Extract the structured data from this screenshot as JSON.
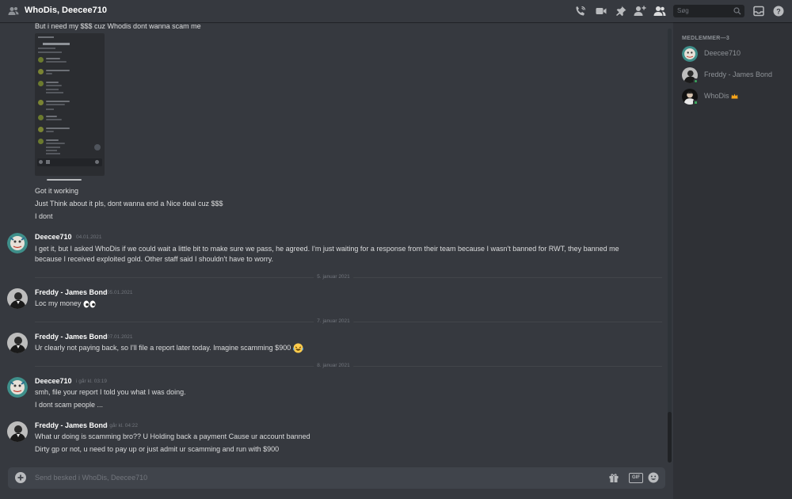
{
  "header": {
    "title": "WhoDis, Deecee710",
    "search_placeholder": "Søg",
    "icons": [
      "group-dm-icon",
      "call-icon",
      "video-icon",
      "pin-icon",
      "add-member-icon",
      "members-icon",
      "search-icon",
      "inbox-icon",
      "help-icon"
    ]
  },
  "messages": {
    "m0_line1": "But i need my $$$ cuz Whodis dont wanna scam me",
    "m0_line2": "Got it working",
    "m0_line3": "Just Think about it pls, dont wanna end a Nice deal cuz $$$",
    "m0_line4": "I dont",
    "m1_author": "Deecee710",
    "m1_time": "04.01.2021",
    "m1_line1": "I get it, but I asked WhoDis if we could wait a little bit to make sure we pass, he agreed. I'm just waiting for a response from their team because I wasn't banned for RWT, they banned me",
    "m1_line2": "because I received exploited gold. Other staff said I shouldn't have to worry.",
    "div1": "5. januar 2021",
    "m2_author": "Freddy - James Bond",
    "m2_time": "05.01.2021",
    "m2_line1": "Loc my money",
    "div2": "7. januar 2021",
    "m3_author": "Freddy - James Bond",
    "m3_time": "07.01.2021",
    "m3_line1": "Ur clearly not paying back, so I'll file a report later today. Imagine scamming $900",
    "div3": "8. januar 2021",
    "m4_author": "Deecee710",
    "m4_time": "i går kl. 03:19",
    "m4_line1": "smh, file your report I told you what I was doing.",
    "m4_line2": "I dont scam people ...",
    "m5_author": "Freddy - James Bond",
    "m5_time": "i går kl. 04:22",
    "m5_line1": "What ur doing is scamming bro?? U Holding back a payment Cause ur account banned",
    "m5_line2": "Dirty gp or not, u need to pay up or just admit ur scamming and run with $900"
  },
  "input": {
    "placeholder": "Send besked i WhoDis, Deecee710",
    "gif_label": "GIF"
  },
  "members": {
    "heading": "MEDLEMMER—3",
    "list": [
      {
        "name": "Deecee710"
      },
      {
        "name": "Freddy - James Bond"
      },
      {
        "name": "WhoDis"
      }
    ]
  },
  "colors": {
    "background": "#36393f",
    "sidebar": "#2f3136",
    "online": "#3ba55d",
    "crown": "#faa61a"
  }
}
